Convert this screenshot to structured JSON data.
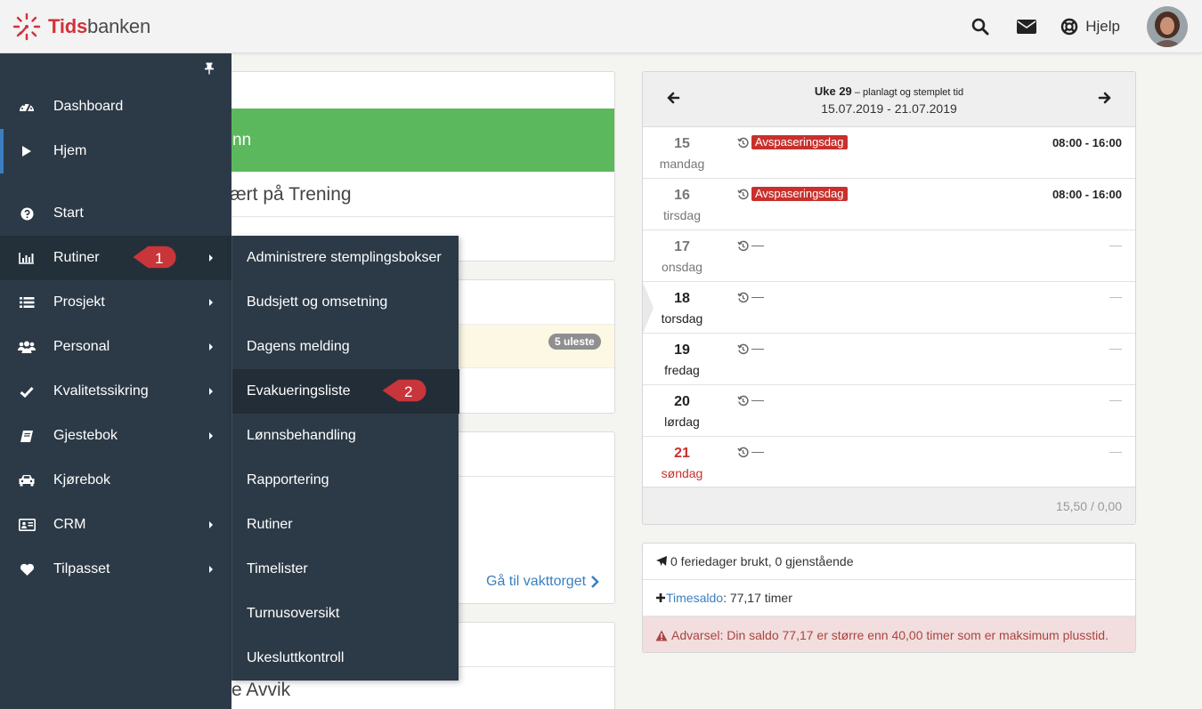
{
  "app": {
    "logo_part1": "Tids",
    "logo_part2": "banken",
    "help_label": "Hjelp"
  },
  "sidebar": {
    "items": [
      {
        "label": "Dashboard",
        "icon": "dashboard-icon",
        "has_submenu": false
      },
      {
        "label": "Hjem",
        "icon": "play-icon",
        "has_submenu": false
      },
      {
        "label": "Start",
        "icon": "question-icon",
        "has_submenu": false
      },
      {
        "label": "Rutiner",
        "icon": "bar-chart-icon",
        "has_submenu": true
      },
      {
        "label": "Prosjekt",
        "icon": "list-icon",
        "has_submenu": true
      },
      {
        "label": "Personal",
        "icon": "users-icon",
        "has_submenu": true
      },
      {
        "label": "Kvalitetssikring",
        "icon": "check-icon",
        "has_submenu": true
      },
      {
        "label": "Gjestebok",
        "icon": "book-icon",
        "has_submenu": true
      },
      {
        "label": "Kjørebok",
        "icon": "car-icon",
        "has_submenu": false
      },
      {
        "label": "CRM",
        "icon": "id-card-icon",
        "has_submenu": true
      },
      {
        "label": "Tilpasset",
        "icon": "heart-icon",
        "has_submenu": true
      }
    ]
  },
  "submenu": {
    "items": [
      "Administrere stemplingsbokser",
      "Budsjett og omsetning",
      "Dagens melding",
      "Evakueringsliste",
      "Lønnsbehandling",
      "Rapportering",
      "Rutiner",
      "Timelister",
      "Turnusoversikt",
      "Ukesluttkontroll"
    ]
  },
  "callouts": {
    "first": "1",
    "second": "2"
  },
  "main": {
    "green_fragment": "nn",
    "trening_fragment": "ært på Trening",
    "unread_badge": "5 uleste",
    "vakt_link": "Gå til vakttorget",
    "avvik_fragment": "re Avvik"
  },
  "week": {
    "title_bold": "Uke 29",
    "title_rest": " – planlagt og stemplet tid",
    "range": "15.07.2019 - 21.07.2019",
    "days": [
      {
        "num": "15",
        "name": "mandag",
        "badge": "Avspaseringsdag",
        "time": "08:00 - 16:00",
        "kind": "past"
      },
      {
        "num": "16",
        "name": "tirsdag",
        "badge": "Avspaseringsdag",
        "time": "08:00 - 16:00",
        "kind": "past"
      },
      {
        "num": "17",
        "name": "onsdag",
        "dash": "—",
        "time_dash": "—",
        "kind": "past"
      },
      {
        "num": "18",
        "name": "torsdag",
        "dash": "—",
        "time_dash": "—",
        "kind": "current"
      },
      {
        "num": "19",
        "name": "fredag",
        "dash": "—",
        "time_dash": "—",
        "kind": "future"
      },
      {
        "num": "20",
        "name": "lørdag",
        "dash": "—",
        "time_dash": "—",
        "kind": "future"
      },
      {
        "num": "21",
        "name": "søndag",
        "dash": "—",
        "time_dash": "—",
        "kind": "sunday"
      }
    ],
    "total": "15,50 / 0,00"
  },
  "info": {
    "vacation": "0 feriedager brukt, 0 gjenstående",
    "timesaldo_link": "Timesaldo",
    "timesaldo_value": ": 77,17 timer",
    "warning": "Advarsel: Din saldo 77,17 er større enn 40,00 timer som er maksimum plusstid."
  },
  "colors": {
    "sidebar_bg": "#2c3a47",
    "accent_red": "#c9302c",
    "callout_red": "#c8353a",
    "link_blue": "#3a7fc1",
    "green": "#5cb85c"
  }
}
